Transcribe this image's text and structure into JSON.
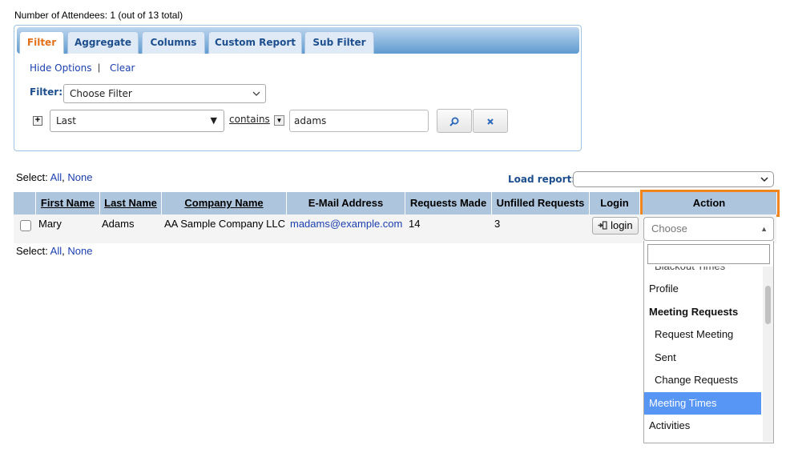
{
  "attendees": {
    "count_text": "Number of Attendees: 1 (out of 13 total)"
  },
  "filter_panel": {
    "tabs": [
      "Filter",
      "Aggregate",
      "Columns",
      "Custom Report",
      "Sub Filter"
    ],
    "active_tab": "Filter",
    "hide_options": "Hide Options",
    "separator": "|",
    "clear": "Clear",
    "filter_label": "Filter:",
    "filter_select_value": "Choose Filter",
    "field_select_value": "Last",
    "operator": "contains",
    "value": "adams"
  },
  "selection": {
    "label": "Select:",
    "all": "All",
    "comma": ",",
    "none": "None"
  },
  "load_report": {
    "label": "Load report:",
    "value": ""
  },
  "table": {
    "columns": [
      "First Name",
      "Last Name",
      "Company Name",
      "E-Mail Address",
      "Requests Made",
      "Unfilled Requests",
      "Login",
      "Action"
    ],
    "rows": [
      {
        "first_name": "Mary",
        "last_name": "Adams",
        "company": "AA Sample Company LLC",
        "email": "madams@example.com",
        "requests_made": "14",
        "unfilled_requests": "3",
        "login_label": "login"
      }
    ]
  },
  "action_dropdown": {
    "placeholder": "Choose",
    "search_value": "",
    "items": [
      {
        "label": "Blackout Times",
        "type": "sub",
        "clipped": true
      },
      {
        "label": "Profile",
        "type": "item"
      },
      {
        "label": "Meeting Requests",
        "type": "group"
      },
      {
        "label": "Request Meeting",
        "type": "sub"
      },
      {
        "label": "Sent",
        "type": "sub"
      },
      {
        "label": "Change Requests",
        "type": "sub"
      },
      {
        "label": "Meeting Times",
        "type": "item",
        "selected": true
      },
      {
        "label": "Activities",
        "type": "item"
      }
    ]
  },
  "colors": {
    "accent": "#e2711a",
    "header_bg": "#adc6dd",
    "link": "#1a3fb0",
    "highlight": "#f1841f",
    "selection": "#5896f6"
  },
  "icons": [
    "plus-icon",
    "chevron-down-icon",
    "search-icon",
    "close-icon",
    "login-icon"
  ]
}
